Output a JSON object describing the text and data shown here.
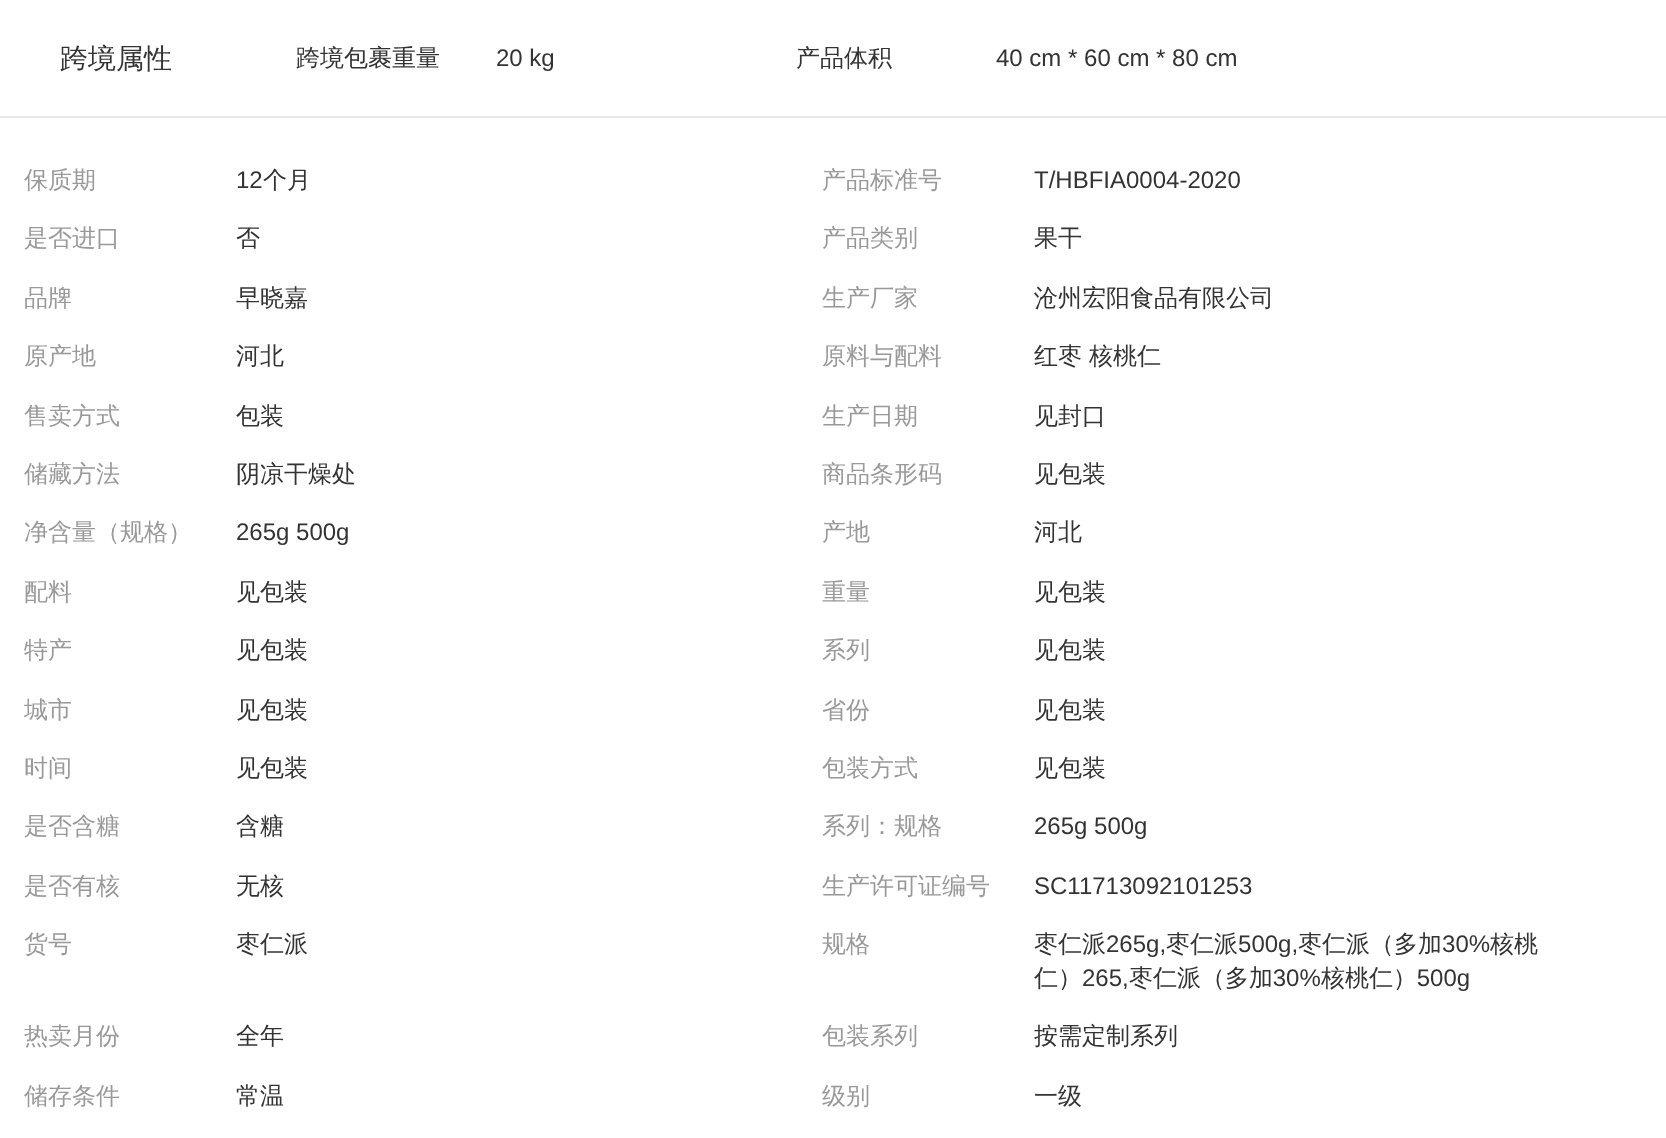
{
  "cross_border": {
    "title": "跨境属性",
    "fields": [
      {
        "label": "跨境包裹重量",
        "value": "20 kg"
      },
      {
        "label": "产品体积",
        "value": "40 cm * 60 cm * 80 cm"
      }
    ]
  },
  "attributes": [
    [
      {
        "label": "保质期",
        "value": "12个月"
      },
      {
        "label": "产品标准号",
        "value": "T/HBFIA0004-2020"
      }
    ],
    [
      {
        "label": "是否进口",
        "value": "否"
      },
      {
        "label": "产品类别",
        "value": "果干"
      }
    ],
    [
      {
        "label": "品牌",
        "value": "早晓嘉"
      },
      {
        "label": "生产厂家",
        "value": "沧州宏阳食品有限公司"
      }
    ],
    [
      {
        "label": "原产地",
        "value": "河北"
      },
      {
        "label": "原料与配料",
        "value": "红枣 核桃仁"
      }
    ],
    [
      {
        "label": "售卖方式",
        "value": "包装"
      },
      {
        "label": "生产日期",
        "value": "见封口"
      }
    ],
    [
      {
        "label": "储藏方法",
        "value": "阴凉干燥处"
      },
      {
        "label": "商品条形码",
        "value": "见包装"
      }
    ],
    [
      {
        "label": "净含量（规格）",
        "value": "265g 500g"
      },
      {
        "label": "产地",
        "value": "河北"
      }
    ],
    [
      {
        "label": "配料",
        "value": "见包装"
      },
      {
        "label": "重量",
        "value": "见包装"
      }
    ],
    [
      {
        "label": "特产",
        "value": "见包装"
      },
      {
        "label": "系列",
        "value": "见包装"
      }
    ],
    [
      {
        "label": "城市",
        "value": "见包装"
      },
      {
        "label": "省份",
        "value": "见包装"
      }
    ],
    [
      {
        "label": "时间",
        "value": "见包装"
      },
      {
        "label": "包装方式",
        "value": "见包装"
      }
    ],
    [
      {
        "label": "是否含糖",
        "value": "含糖"
      },
      {
        "label": "系列：规格",
        "value": "265g 500g"
      }
    ],
    [
      {
        "label": "是否有核",
        "value": "无核"
      },
      {
        "label": "生产许可证编号",
        "value": "SC11713092101253"
      }
    ],
    [
      {
        "label": "货号",
        "value": "枣仁派"
      },
      {
        "label": "规格",
        "value": "枣仁派265g,枣仁派500g,枣仁派（多加30%核桃仁）265,枣仁派（多加30%核桃仁）500g"
      }
    ],
    [
      {
        "label": "热卖月份",
        "value": "全年"
      },
      {
        "label": "包装系列",
        "value": "按需定制系列"
      }
    ],
    [
      {
        "label": "储存条件",
        "value": "常温"
      },
      {
        "label": "级别",
        "value": "一级"
      }
    ]
  ]
}
